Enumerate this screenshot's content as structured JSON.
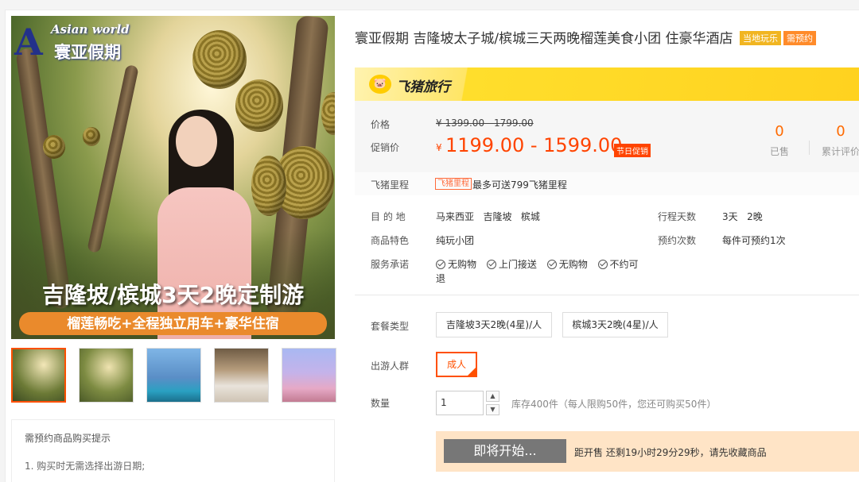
{
  "logo": {
    "letter": "A",
    "en": "Asian world",
    "cn": "寰亚假期"
  },
  "banner": {
    "title": "吉隆坡/槟城3天2晚定制游",
    "subtitle": "榴莲畅吃+全程独立用车+豪华住宿"
  },
  "notice": {
    "heading": "需预约商品购买提示",
    "line1": "1. 购买时无需选择出游日期;"
  },
  "product": {
    "title": "寰亚假期 吉隆坡太子城/槟城三天两晚榴莲美食小团 住豪华酒店",
    "tags": [
      "当地玩乐",
      "需预约"
    ]
  },
  "platform": {
    "icon": "pig-icon",
    "name": "飞猪旅行"
  },
  "price": {
    "label": "价格",
    "original": "¥ 1399.00 - 1799.00",
    "sale_label": "促销价",
    "currency": "¥",
    "sale": "1199.00 - 1599.00",
    "badge": "节日促销"
  },
  "stats": [
    {
      "value": "0",
      "caption": "已售"
    },
    {
      "value": "0",
      "caption": "累计评价"
    }
  ],
  "mileage": {
    "label": "飞猪里程",
    "tag": "飞猪里程",
    "text": "最多可送799飞猪里程"
  },
  "info": {
    "destination_label": "目 的 地",
    "destination": "马来西亚   吉隆坡   槟城",
    "days_label": "行程天数",
    "days": "3天   2晚",
    "feature_label": "商品特色",
    "feature": "纯玩小团",
    "booking_label": "预约次数",
    "booking": "每件可预约1次",
    "promise_label": "服务承诺",
    "promises": [
      "无购物",
      "上门接送",
      "无购物",
      "不约可退"
    ]
  },
  "package": {
    "label": "套餐类型",
    "options": [
      "吉隆坡3天2晚(4星)/人",
      "槟城3天2晚(4星)/人"
    ]
  },
  "travelers": {
    "label": "出游人群",
    "options": [
      "成人"
    ]
  },
  "quantity": {
    "label": "数量",
    "value": "1",
    "stock": "库存400件（每人限购50件，您还可购买50件）"
  },
  "buy": {
    "button": "即将开始...",
    "countdown": "距开售 还剩19小时29分29秒，请先收藏商品"
  }
}
